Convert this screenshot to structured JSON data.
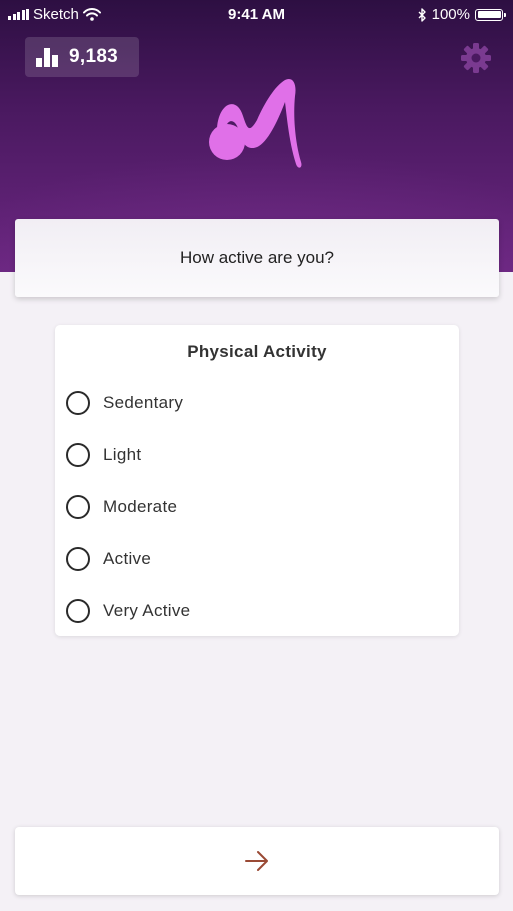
{
  "status_bar": {
    "carrier": "Sketch",
    "time": "9:41 AM",
    "battery_percent": "100%",
    "icons": [
      "signal-icon",
      "wifi-icon",
      "bluetooth-icon",
      "battery-icon"
    ]
  },
  "header": {
    "score": "9,183",
    "score_icon": "bar-chart-icon",
    "settings_icon": "gear-icon",
    "logo": "m-logo"
  },
  "question": {
    "text": "How active are you?"
  },
  "activity": {
    "title": "Physical Activity",
    "options": [
      {
        "label": "Sedentary",
        "selected": false
      },
      {
        "label": "Light",
        "selected": false
      },
      {
        "label": "Moderate",
        "selected": false
      },
      {
        "label": "Active",
        "selected": false
      },
      {
        "label": "Very Active",
        "selected": false
      }
    ]
  },
  "footer": {
    "next_icon": "arrow-right-icon"
  },
  "colors": {
    "header_dark": "#2d0f42",
    "header_light": "#6a2680",
    "logo": "#e070e8",
    "gear": "#7a3a90",
    "arrow": "#9a4a35",
    "background": "#f4f1f6"
  }
}
